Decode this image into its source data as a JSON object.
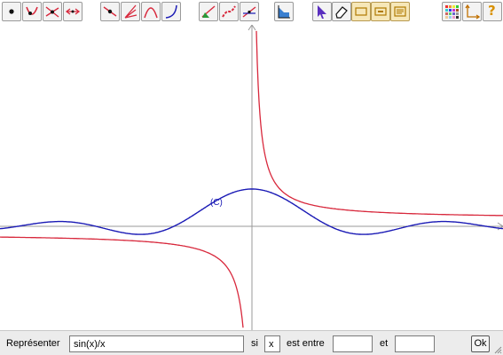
{
  "toolbar": {
    "icons": [
      "point-icon",
      "point-on-curve-icon",
      "intersection-point-icon",
      "translation-icon",
      "segment-point-icon",
      "bisector-icon",
      "parabola-icon",
      "curve-icon",
      "tangent-icon",
      "chain-curve-icon",
      "secant-icon",
      "area-icon",
      "pointer-icon",
      "eraser-icon",
      "frame-icon",
      "label-frame-icon",
      "text-frame-icon",
      "color-palette-icon",
      "axes-icon",
      "help-icon"
    ],
    "help_label": "?"
  },
  "graph": {
    "curve_label": "(C)",
    "colors": {
      "blue_curve": "#1a1ab5",
      "red_curve": "#d8283c",
      "axis": "#9a9a9a"
    }
  },
  "command_bar": {
    "represent_label": "Représenter",
    "function_value": "sin(x)/x",
    "si_label": "si",
    "variable_value": "x",
    "between_label": "est entre",
    "min_value": "",
    "and_label": "et",
    "max_value": "",
    "ok_label": "Ok"
  }
}
